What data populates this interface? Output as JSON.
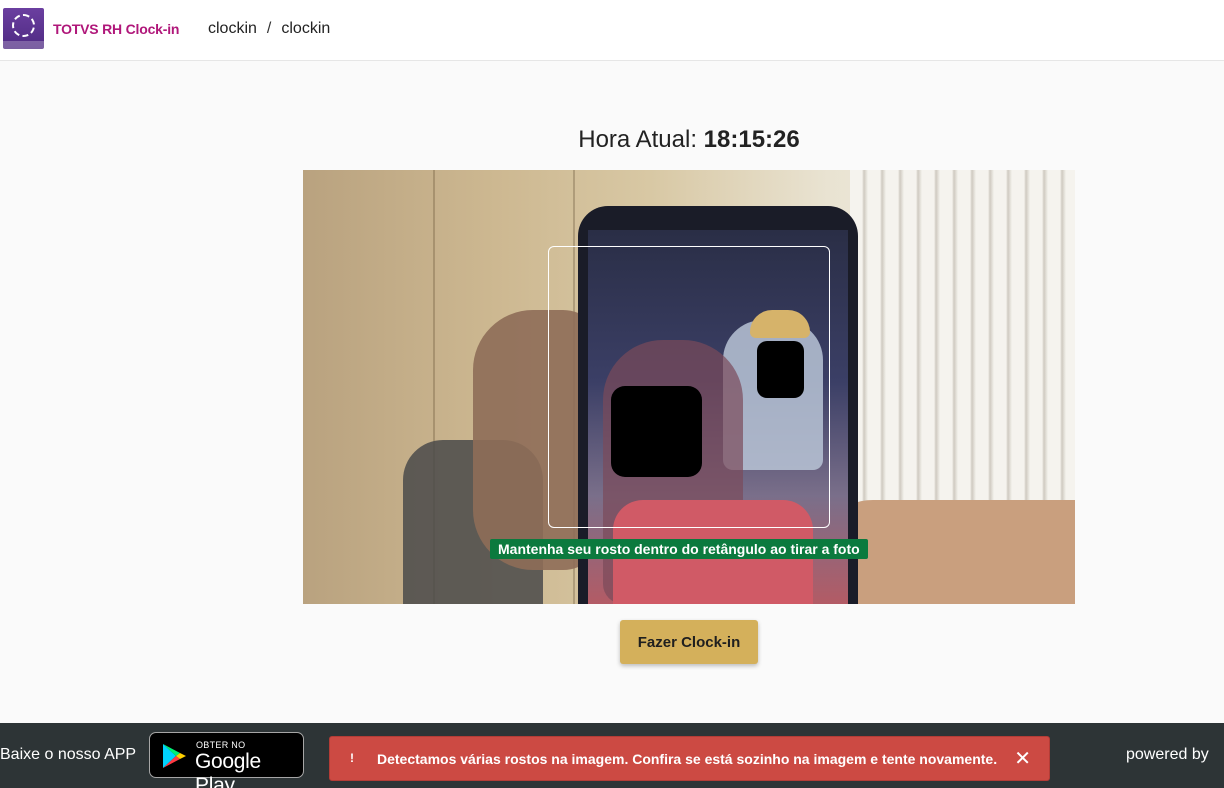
{
  "header": {
    "app_title": "TOTVS RH Clock-in",
    "breadcrumb": [
      "clockin",
      "clockin"
    ],
    "breadcrumb_sep": "/"
  },
  "clock": {
    "label": "Hora Atual:",
    "time": "18:15:26"
  },
  "camera": {
    "hint": "Mantenha seu rosto dentro do retângulo ao tirar a foto"
  },
  "actions": {
    "clockin_label": "Fazer Clock-in"
  },
  "footer": {
    "download_text": "Baixe o nosso APP",
    "store_small": "OBTER NO",
    "store_big": "Google Play",
    "alert_icon": "!",
    "alert_message": "Detectamos várias rostos na imagem. Confira se está sozinho na imagem e tente novamente.",
    "alert_close": "✕",
    "powered_by": "powered by"
  },
  "icons": {
    "logo": "totvs-logo-icon",
    "store": "google-play-icon",
    "alert": "alert-icon",
    "close": "close-icon"
  },
  "colors": {
    "brand_title": "#b0177a",
    "logo": "#5b3390",
    "hint_bg": "#0b7a3e",
    "button_bg": "#d4b05b",
    "footer_bg": "#2d3436",
    "alert_bg": "#cc4a43"
  }
}
